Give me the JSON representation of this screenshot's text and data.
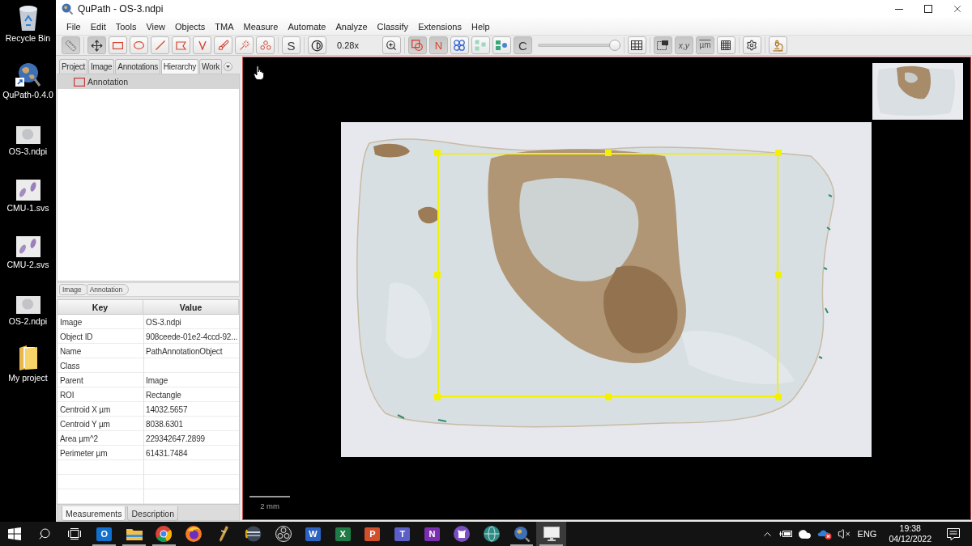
{
  "desktop_icons": [
    {
      "kind": "trash",
      "label": "Recycle Bin"
    },
    {
      "kind": "shortcut",
      "label": "QuPath-0.4.0"
    },
    {
      "kind": "tissue",
      "label": "OS-3.ndpi"
    },
    {
      "kind": "stained",
      "label": "CMU-1.svs"
    },
    {
      "kind": "stained",
      "label": "CMU-2.svs"
    },
    {
      "kind": "tissue",
      "label": "OS-2.ndpi"
    },
    {
      "kind": "folder",
      "label": "My project"
    }
  ],
  "window": {
    "title": "QuPath - OS-3.ndpi"
  },
  "menu": [
    "File",
    "Edit",
    "Tools",
    "View",
    "Objects",
    "TMA",
    "Measure",
    "Automate",
    "Analyze",
    "Classify",
    "Extensions",
    "Help"
  ],
  "toolbar": [
    {
      "items": [
        {
          "kind": "ruler",
          "selected": true
        }
      ]
    },
    {
      "items": [
        {
          "kind": "move",
          "selected": true
        },
        {
          "kind": "rectangle",
          "selected": false
        },
        {
          "kind": "ellipse",
          "selected": false
        },
        {
          "kind": "line",
          "selected": false
        },
        {
          "kind": "polygon",
          "selected": false
        },
        {
          "kind": "polyline",
          "selected": false
        },
        {
          "kind": "brush",
          "selected": false
        },
        {
          "kind": "wand",
          "selected": false
        },
        {
          "kind": "points",
          "selected": false
        }
      ]
    },
    {
      "items": [
        {
          "kind": "text",
          "label": "S",
          "selected": false
        }
      ]
    },
    {
      "items": [
        {
          "kind": "contrast",
          "selected": false
        },
        {
          "kind": "readout",
          "label": "0.28x"
        },
        {
          "kind": "zoom",
          "selected": false
        }
      ]
    },
    {
      "items": [
        {
          "kind": "annotations",
          "selected": true
        },
        {
          "kind": "names",
          "label": "N",
          "selected": true
        },
        {
          "kind": "tma",
          "selected": false
        },
        {
          "kind": "detections",
          "selected": false
        },
        {
          "kind": "fill",
          "selected": false
        },
        {
          "kind": "text",
          "label": "C",
          "selected": true
        },
        {
          "kind": "slider",
          "level": 1
        }
      ]
    },
    {
      "items": [
        {
          "kind": "table",
          "selected": false
        }
      ]
    },
    {
      "items": [
        {
          "kind": "overview",
          "selected": true
        },
        {
          "kind": "location",
          "label": "x,y",
          "selected": true
        },
        {
          "kind": "scalebar",
          "label": "µm",
          "selected": true
        },
        {
          "kind": "grid",
          "selected": false
        }
      ]
    },
    {
      "items": [
        {
          "kind": "settings",
          "selected": false
        }
      ]
    },
    {
      "items": [
        {
          "kind": "log",
          "selected": false
        }
      ]
    }
  ],
  "left_panel": {
    "tabs": [
      {
        "label": "Project",
        "selected": false
      },
      {
        "label": "Image",
        "selected": false
      },
      {
        "label": "Annotations",
        "selected": false
      },
      {
        "label": "Hierarchy",
        "selected": true
      },
      {
        "label": "Work",
        "selected": false
      }
    ],
    "hierarchy": [
      {
        "label": "Annotation",
        "selected": true
      }
    ],
    "breadcrumb": [
      "Image",
      "Annotation"
    ],
    "table": {
      "columns": [
        "Key",
        "Value"
      ],
      "rows": [
        [
          "Image",
          "OS-3.ndpi"
        ],
        [
          "Object ID",
          "908ceede-01e2-4ccd-92..."
        ],
        [
          "Name",
          "PathAnnotationObject"
        ],
        [
          "Class",
          ""
        ],
        [
          "Parent",
          "Image"
        ],
        [
          "ROI",
          "Rectangle"
        ],
        [
          "Centroid X µm",
          "14032.5657"
        ],
        [
          "Centroid Y µm",
          "8038.6301"
        ],
        [
          "Area µm^2",
          "229342647.2899"
        ],
        [
          "Perimeter µm",
          "61431.7484"
        ]
      ]
    },
    "bottom_tabs": [
      {
        "label": "Measurements",
        "selected": true
      },
      {
        "label": "Description",
        "selected": false
      }
    ]
  },
  "viewer": {
    "annotation": {
      "selected": true
    },
    "scale_bar": "2 mm"
  },
  "taskbar": {
    "apps": [
      {
        "kind": "outlook",
        "glyph": "O",
        "running": true,
        "selected": false
      },
      {
        "kind": "explorer",
        "running": true,
        "selected": false
      },
      {
        "kind": "chrome",
        "running": true,
        "selected": false
      },
      {
        "kind": "firefox",
        "running": false,
        "selected": false
      },
      {
        "kind": "pen",
        "running": false,
        "selected": false
      },
      {
        "kind": "disc",
        "running": false,
        "selected": false
      },
      {
        "kind": "obs",
        "running": false,
        "selected": false
      },
      {
        "kind": "word",
        "glyph": "W",
        "running": false,
        "selected": false
      },
      {
        "kind": "excel",
        "glyph": "X",
        "running": false,
        "selected": false
      },
      {
        "kind": "powerpoint",
        "glyph": "P",
        "running": false,
        "selected": false
      },
      {
        "kind": "teams",
        "glyph": "T",
        "running": false,
        "selected": false
      },
      {
        "kind": "onenote",
        "glyph": "N",
        "running": false,
        "selected": false
      },
      {
        "kind": "github",
        "running": false,
        "selected": false
      },
      {
        "kind": "globe",
        "running": false,
        "selected": false
      },
      {
        "kind": "qupath",
        "running": true,
        "selected": false
      },
      {
        "kind": "display",
        "running": true,
        "selected": true
      }
    ],
    "language": "ENG",
    "time": "19:38",
    "date": "04/12/2022"
  }
}
